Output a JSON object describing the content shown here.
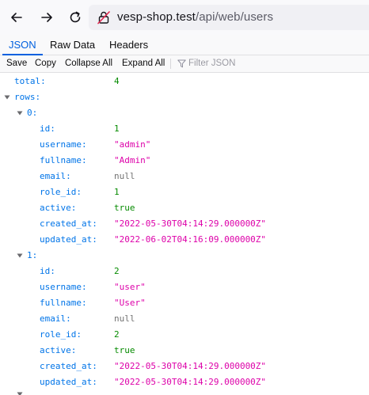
{
  "browser": {
    "url_host": "vesp-shop.test",
    "url_path": "/api/web/users"
  },
  "tabs": [
    {
      "label": "JSON",
      "selected": true
    },
    {
      "label": "Raw Data",
      "selected": false
    },
    {
      "label": "Headers",
      "selected": false
    }
  ],
  "json_toolbar": {
    "save": "Save",
    "copy": "Copy",
    "collapse_all": "Collapse All",
    "expand_all": "Expand All",
    "filter_placeholder": "Filter JSON"
  },
  "tree": {
    "total_key": "total:",
    "total_value": "4",
    "rows_key": "rows:",
    "items": [
      {
        "index_key": "0:",
        "fields": [
          {
            "key": "id:",
            "value": "1",
            "type": "num"
          },
          {
            "key": "username:",
            "value": "\"admin\"",
            "type": "str"
          },
          {
            "key": "fullname:",
            "value": "\"Admin\"",
            "type": "str"
          },
          {
            "key": "email:",
            "value": "null",
            "type": "nul"
          },
          {
            "key": "role_id:",
            "value": "1",
            "type": "num"
          },
          {
            "key": "active:",
            "value": "true",
            "type": "boo"
          },
          {
            "key": "created_at:",
            "value": "\"2022-05-30T04:14:29.000000Z\"",
            "type": "str"
          },
          {
            "key": "updated_at:",
            "value": "\"2022-06-02T04:16:09.000000Z\"",
            "type": "str"
          }
        ]
      },
      {
        "index_key": "1:",
        "fields": [
          {
            "key": "id:",
            "value": "2",
            "type": "num"
          },
          {
            "key": "username:",
            "value": "\"user\"",
            "type": "str"
          },
          {
            "key": "fullname:",
            "value": "\"User\"",
            "type": "str"
          },
          {
            "key": "email:",
            "value": "null",
            "type": "nul"
          },
          {
            "key": "role_id:",
            "value": "2",
            "type": "num"
          },
          {
            "key": "active:",
            "value": "true",
            "type": "boo"
          },
          {
            "key": "created_at:",
            "value": "\"2022-05-30T04:14:29.000000Z\"",
            "type": "str"
          },
          {
            "key": "updated_at:",
            "value": "\"2022-05-30T04:14:29.000000Z\"",
            "type": "str"
          }
        ]
      }
    ]
  }
}
